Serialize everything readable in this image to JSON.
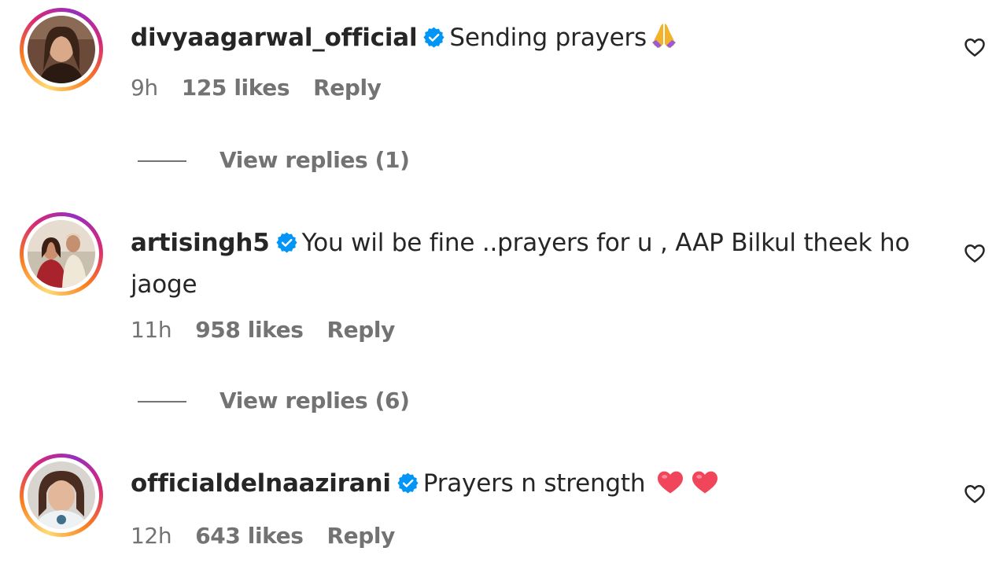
{
  "comments": [
    {
      "username": "divyaagarwal_official",
      "verified": true,
      "text": "Sending prayers",
      "emoji": "folded-hands-emoji",
      "time": "9h",
      "likes": "125 likes",
      "reply_label": "Reply",
      "view_replies": "View replies (1)"
    },
    {
      "username": "artisingh5",
      "verified": true,
      "text": "You wil be fine ..prayers for u , AAP Bilkul theek ho jaoge",
      "time": "11h",
      "likes": "958 likes",
      "reply_label": "Reply",
      "view_replies": "View replies (6)"
    },
    {
      "username": "officialdelnaazirani",
      "verified": true,
      "text": "Prayers n strength",
      "emoji": "red-heart-emoji x2",
      "time": "12h",
      "likes": "643 likes",
      "reply_label": "Reply"
    }
  ],
  "colors": {
    "text_primary": "#262626",
    "text_secondary": "#737373",
    "verified_blue": "#0095f6",
    "background": "#ffffff"
  },
  "icons": {
    "like": "heart-outline-icon",
    "verified": "verified-badge-icon"
  }
}
